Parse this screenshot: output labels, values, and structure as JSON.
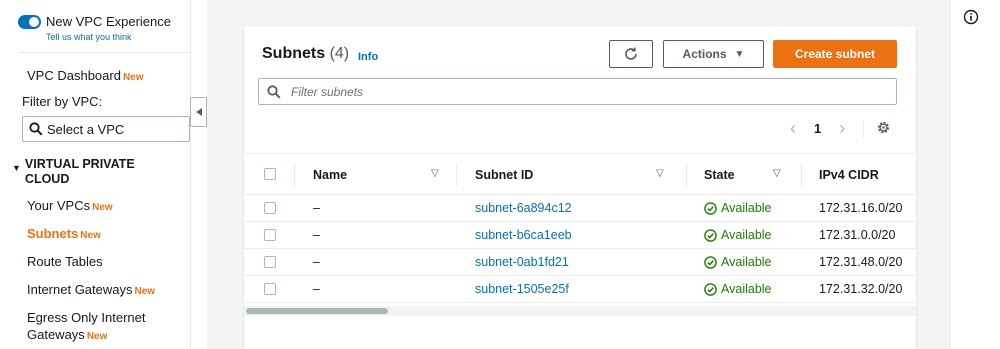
{
  "sidebar": {
    "toggle_label": "New VPC Experience",
    "toggle_link": "Tell us what you think",
    "dashboard_label": "VPC Dashboard",
    "new_badge": "New",
    "filter_label": "Filter by VPC:",
    "vpc_select_placeholder": "Select a VPC",
    "section_title": "VIRTUAL PRIVATE CLOUD",
    "items": [
      {
        "label": "Your VPCs",
        "badge": "New",
        "active": false
      },
      {
        "label": "Subnets",
        "badge": "New",
        "active": true
      },
      {
        "label": "Route Tables",
        "badge": "",
        "active": false
      },
      {
        "label": "Internet Gateways",
        "badge": "New",
        "active": false
      },
      {
        "label": "Egress Only Internet Gateways",
        "badge": "New",
        "active": false
      }
    ]
  },
  "panel": {
    "title": "Subnets",
    "count": "(4)",
    "info_label": "Info",
    "actions_label": "Actions",
    "create_label": "Create subnet",
    "search_placeholder": "Filter subnets",
    "page": "1"
  },
  "table": {
    "columns": [
      "Name",
      "Subnet ID",
      "State",
      "IPv4 CIDR"
    ],
    "rows": [
      {
        "name": "–",
        "subnet_id": "subnet-6a894c12",
        "state": "Available",
        "cidr": "172.31.16.0/20"
      },
      {
        "name": "–",
        "subnet_id": "subnet-b6ca1eeb",
        "state": "Available",
        "cidr": "172.31.0.0/20"
      },
      {
        "name": "–",
        "subnet_id": "subnet-0ab1fd21",
        "state": "Available",
        "cidr": "172.31.48.0/20"
      },
      {
        "name": "–",
        "subnet_id": "subnet-1505e25f",
        "state": "Available",
        "cidr": "172.31.32.0/20"
      }
    ]
  },
  "colors": {
    "accent": "#ec7211",
    "link": "#0073bb",
    "success": "#1d8102"
  },
  "icons": [
    "search-icon",
    "refresh-icon",
    "caret-down-icon",
    "chevron-left-icon",
    "chevron-right-icon",
    "gear-icon",
    "check-circle-icon",
    "info-icon"
  ]
}
